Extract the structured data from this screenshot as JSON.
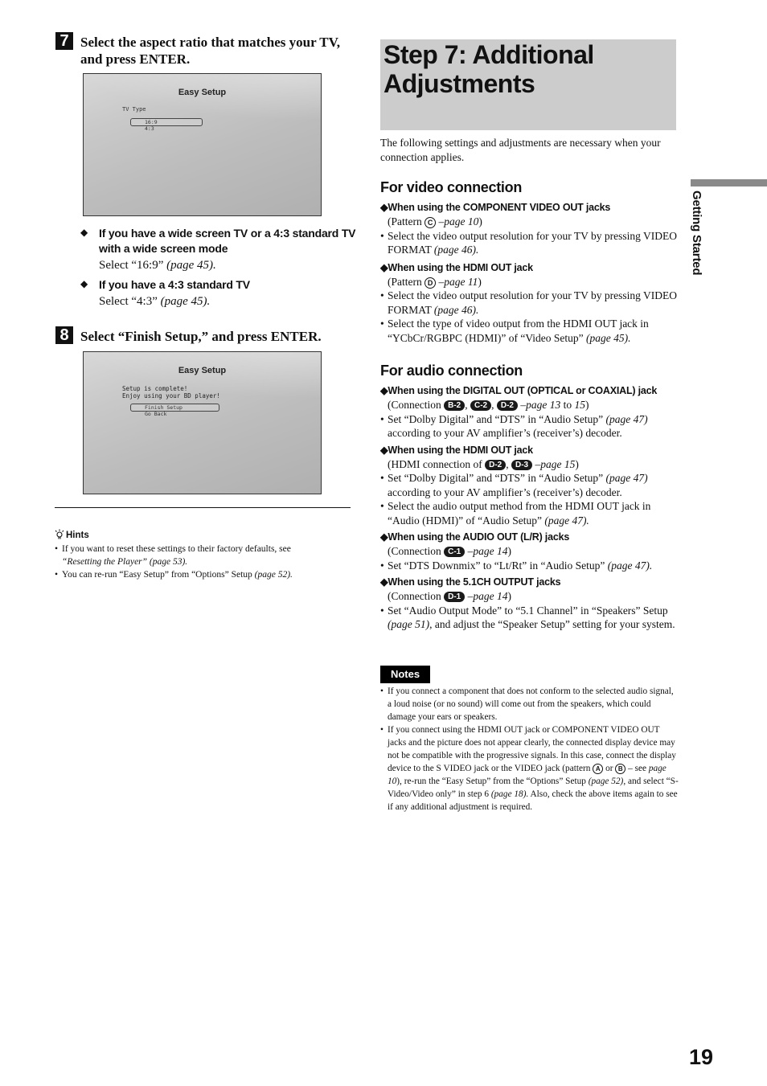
{
  "left": {
    "step7": {
      "number": "7",
      "title_line1": "Select the aspect ratio that matches your TV,",
      "title_line2": "and press ENTER.",
      "screen": {
        "title": "Easy Setup",
        "label": "TV Type",
        "options": [
          "16:9",
          "4:3"
        ],
        "selected": "16:9"
      },
      "bullets": [
        {
          "icon": "diamond",
          "heading_line1": "If you have a wide screen TV or a 4:3 standard TV",
          "heading_line2": "with a wide screen mode",
          "text": "Select “16:9”",
          "ref": "(page 45)."
        },
        {
          "icon": "diamond",
          "heading_line1": "If you have a 4:3 standard TV",
          "text": "Select “4:3”",
          "ref": "(page 45)."
        }
      ]
    },
    "step8": {
      "number": "8",
      "title": "Select “Finish Setup,” and press ENTER.",
      "screen": {
        "title": "Easy Setup",
        "message_line1": "Setup is complete!",
        "message_line2": "Enjoy using your BD player!",
        "options": [
          "Finish Setup",
          "Go Back"
        ],
        "selected": "Finish Setup"
      }
    },
    "hints": {
      "title": "Hints",
      "items": [
        {
          "line1": "If you want to reset these settings to their factory defaults, see",
          "link": "“Resetting the Player” (page 53)."
        },
        {
          "text": "You can re-run “Easy Setup” from “Options” Setup ",
          "ref": "(page 52)."
        }
      ]
    }
  },
  "right": {
    "title_line1": "Step 7: Additional",
    "title_line2": "Adjustments",
    "intro": "The following settings and adjustments are necessary when your connection applies.",
    "video": {
      "heading": "For video connection",
      "subsections": [
        {
          "heading": "◆When using the COMPONENT VIDEO OUT jacks",
          "ref_prefix": "(Pattern ",
          "ref_circle": "C",
          "ref_page": " –page 10",
          "ref_suffix": ")",
          "bullets": [
            {
              "text": "Select the video output resolution for your TV by pressing VIDEO FORMAT ",
              "ref": "(page 46)."
            }
          ]
        },
        {
          "heading": "◆When using the HDMI OUT jack",
          "ref_prefix": "(Pattern ",
          "ref_circle": "D",
          "ref_page": " –page 11",
          "ref_suffix": ")",
          "bullets": [
            {
              "text": "Select the video output resolution for your TV by pressing VIDEO FORMAT ",
              "ref": "(page 46)."
            },
            {
              "text": "Select the type of video output from the HDMI OUT jack in “YCbCr/RGBPC (HDMI)” of “Video Setup” ",
              "ref": "(page 45)."
            }
          ]
        }
      ]
    },
    "audio": {
      "heading": "For audio connection",
      "subsections": [
        {
          "heading": "◆When using the DIGITAL OUT (OPTICAL or COAXIAL) jack",
          "ref_prefix": "(Connection ",
          "badges": [
            "B-2",
            "C-2",
            "D-2"
          ],
          "ref_page": "–page 13",
          "ref_mid": " to ",
          "ref_page2": "15",
          "ref_suffix": ")",
          "bullets": [
            {
              "text": "Set “Dolby Digital” and “DTS” in “Audio Setup” ",
              "ref": "(page 47)",
              "after": " according to your AV amplifier’s (receiver’s) decoder."
            }
          ]
        },
        {
          "heading": "◆When using the HDMI OUT jack",
          "ref_prefix": "(HDMI connection of ",
          "badges": [
            "D-2",
            "D-3"
          ],
          "ref_page": "–page 15",
          "ref_suffix": ")",
          "bullets": [
            {
              "text": "Set “Dolby Digital” and “DTS” in “Audio Setup” ",
              "ref": "(page 47)",
              "after": " according to your AV amplifier’s (receiver’s) decoder."
            },
            {
              "text": "Select the audio output method from the HDMI OUT jack in “Audio (HDMI)” of “Audio Setup” ",
              "ref": "(page 47).",
              "after": ""
            }
          ]
        },
        {
          "heading": "◆When using the AUDIO OUT (L/R) jacks",
          "ref_prefix": "(Connection ",
          "badges": [
            "C-1"
          ],
          "ref_page": "–page 14",
          "ref_suffix": ")",
          "bullets": [
            {
              "text": "Set “DTS Downmix” to “Lt/Rt” in “Audio Setup” ",
              "ref": "(page 47).",
              "after": ""
            }
          ]
        },
        {
          "heading": "◆When using the 5.1CH OUTPUT jacks",
          "ref_prefix": "(Connection ",
          "badges": [
            "D-1"
          ],
          "ref_page": "–page 14",
          "ref_suffix": ")",
          "bullets": [
            {
              "text": "Set “Audio Output Mode” to “5.1 Channel” in “Speakers” Setup ",
              "ref": "(page 51)",
              "after": ", and adjust the “Speaker Setup” setting for your system."
            }
          ]
        }
      ]
    },
    "notes": {
      "label": "Notes",
      "item1": "If you connect a component that does not conform to the selected audio signal, a loud noise (or no sound) will come out from the speakers, which could damage your ears or speakers.",
      "item2_a": "If you connect using the HDMI OUT jack or COMPONENT VIDEO OUT jacks and the picture does not appear clearly, the connected display device may not be compatible with the progressive signals. In this case, connect the display device to the S VIDEO jack or the VIDEO jack (pattern ",
      "item2_circle_a": "A",
      "item2_or": " or ",
      "item2_circle_b": "B",
      "item2_see": " – see ",
      "item2_ref1": "page 10",
      "item2_b": "), re-run the “Easy Setup” from the “Options” Setup ",
      "item2_ref2": "(page 52)",
      "item2_c": ", and select “S-Video/Video only” in step 6 ",
      "item2_ref3": "(page 18).",
      "item2_d": " Also, check the above items again to see if any additional adjustment is required."
    }
  },
  "side_tab": "Getting Started",
  "page_number": "19"
}
